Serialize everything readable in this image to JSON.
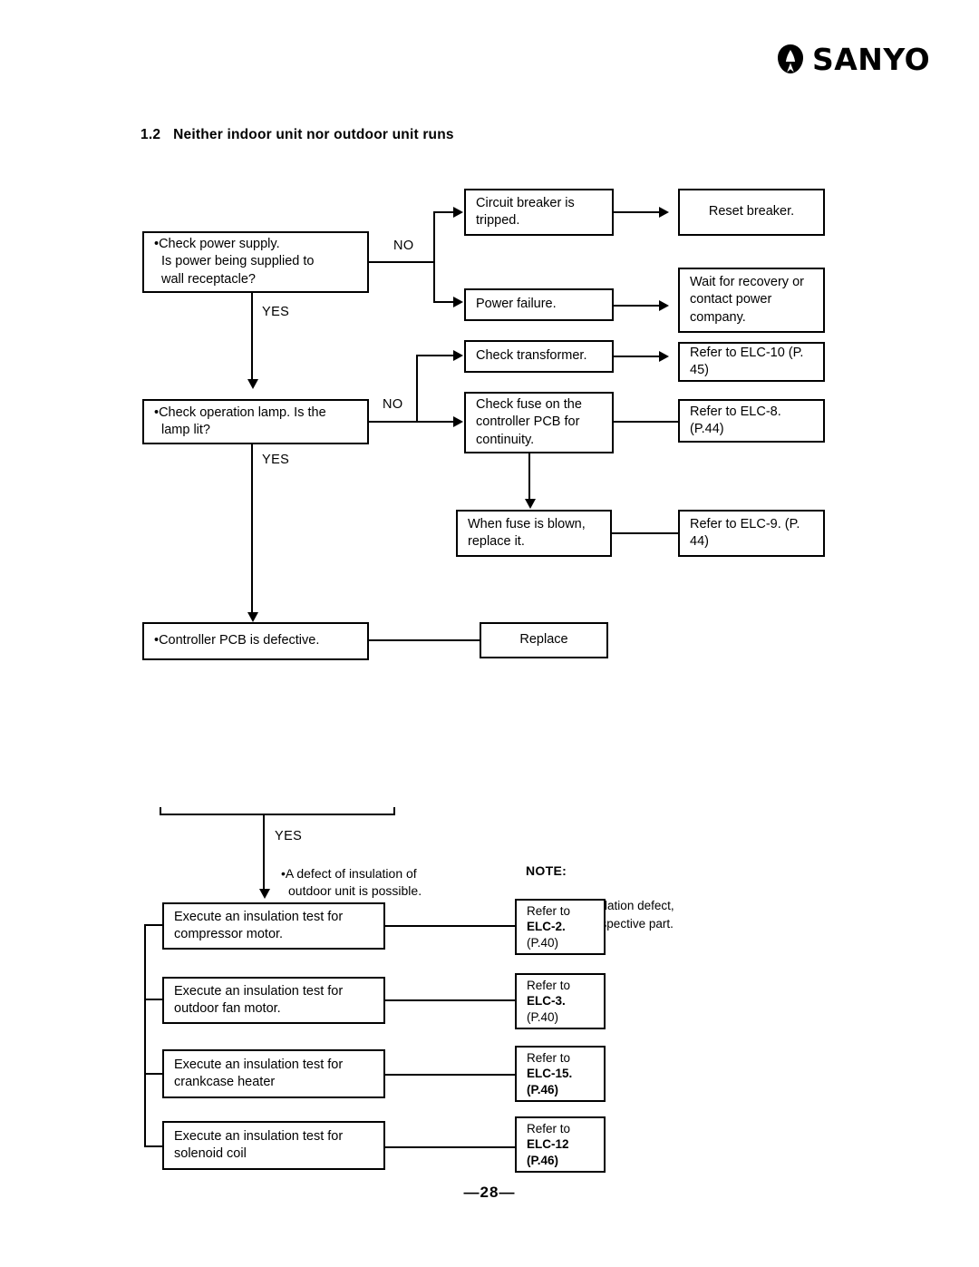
{
  "brand": {
    "name": "SANYO",
    "mark": "sanyo-emblem"
  },
  "heading": {
    "number": "1.2",
    "title": "Neither indoor unit nor outdoor unit runs"
  },
  "flow1": {
    "q1": "•Check power supply.\nIs power being supplied to\nwall receptacle?",
    "q1_no": "NO",
    "q1_yes": "YES",
    "r1a": "Circuit breaker is\ntripped.",
    "r1a_out": "Reset breaker.",
    "r1b": "Power failure.",
    "r1b_out": "Wait for recovery or\ncontact power\ncompany.",
    "q2": "•Check operation lamp. Is the\nlamp lit?",
    "q2_no": "NO",
    "q2_yes": "YES",
    "r2a": "Check transformer.",
    "r2a_out": "Refer to ELC-10 (P.\n45)",
    "r2b": "Check fuse on the\ncontroller PCB for\ncontinuity.",
    "r2b_out": "Refer to  ELC-8.\n(P.44)",
    "r3": "When fuse is blown,\nreplace it.",
    "r3_out": "Refer to ELC-9. (P.\n44)",
    "q3": "•Controller PCB is defective.",
    "q3_out": "Replace"
  },
  "flow2": {
    "yes_label": "YES",
    "defect_text": "•A defect of insulation of\noutdoor unit is possible.",
    "note_title": "NOTE:",
    "note_body": "In case of insulation defect,\nreplace the respective part.",
    "rows": [
      {
        "test": "Execute an insulation test for\ncompressor motor.",
        "ref_lead": "Refer to",
        "ref_code": "ELC-2.",
        "ref_page": "(P.40)",
        "bold": false
      },
      {
        "test": "Execute an insulation test for\noutdoor fan motor.",
        "ref_lead": "Refer to",
        "ref_code": "ELC-3.",
        "ref_page": "(P.40)",
        "bold": false
      },
      {
        "test": "Execute an insulation test for\ncrankcase heater",
        "ref_lead": "Refer to",
        "ref_code": "ELC-15.",
        "ref_page": "(P.46)",
        "bold": true
      },
      {
        "test": "Execute an insulation test for\nsolenoid coil",
        "ref_lead": "Refer to",
        "ref_code": "ELC-12",
        "ref_page": "(P.46)",
        "bold": true
      }
    ]
  },
  "footer": {
    "page": "—28—"
  }
}
